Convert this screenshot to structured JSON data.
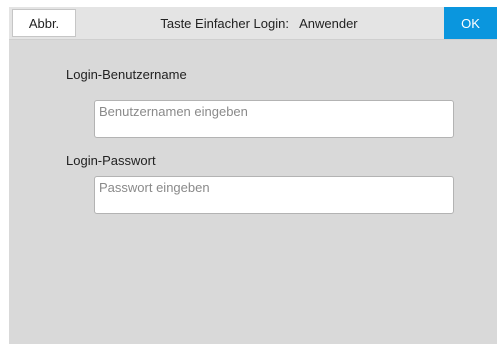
{
  "header": {
    "cancel_label": "Abbr.",
    "title": "Taste Einfacher Login:   Anwender",
    "ok_label": "OK"
  },
  "form": {
    "username_label": "Login-Benutzername",
    "username_placeholder": "Benutzernamen eingeben",
    "username_value": "",
    "password_label": "Login-Passwort",
    "password_placeholder": "Passwort eingeben",
    "password_value": ""
  },
  "colors": {
    "accent": "#0a96de",
    "panel_background": "#d9d9d9"
  }
}
